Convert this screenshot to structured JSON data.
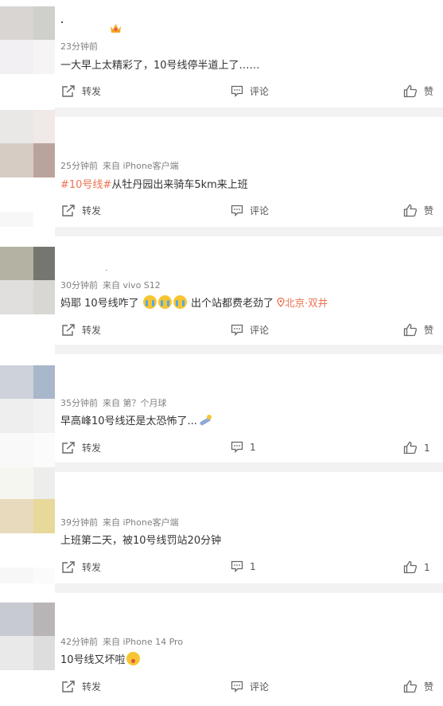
{
  "posts": [
    {
      "time": "23分钟前",
      "source": "",
      "content": "一大早上太精彩了，10号线停半道上了……",
      "forward": "转发",
      "comment": "评论",
      "like": "赞"
    },
    {
      "time": "25分钟前",
      "source": "来自 iPhone客户端",
      "tag": "#10号线#",
      "content": "从牡丹园出来骑车5km来上班",
      "forward": "转发",
      "comment": "评论",
      "like": "赞"
    },
    {
      "time": "30分钟前",
      "source": "来自 vivo S12",
      "content_pre": "妈耶 10号线咋了",
      "content_post": "出个站都费老劲了",
      "location": "北京·双井",
      "forward": "转发",
      "comment": "评论",
      "like": "赞"
    },
    {
      "time": "35分钟前",
      "source": "来自 第？个月球",
      "content": "早高峰10号线还是太恐怖了...",
      "forward": "转发",
      "comment": "1",
      "like": "1"
    },
    {
      "time": "39分钟前",
      "source": "来自 iPhone客户端",
      "content": "上班第二天，被10号线罚站20分钟",
      "forward": "转发",
      "comment": "1",
      "like": "1"
    },
    {
      "time": "42分钟前",
      "source": "来自 iPhone 14 Pro",
      "content": "10号线又坏啦",
      "forward": "转发",
      "comment": "评论",
      "like": "赞"
    }
  ],
  "colors": {
    "accent": "#eb7350",
    "meta": "#808080",
    "text": "#333333",
    "separator": "#f2f2f2"
  },
  "icons": {
    "forward": "share-icon",
    "comment": "comment-icon",
    "like": "thumbs-up-icon",
    "location": "location-pin-icon"
  }
}
